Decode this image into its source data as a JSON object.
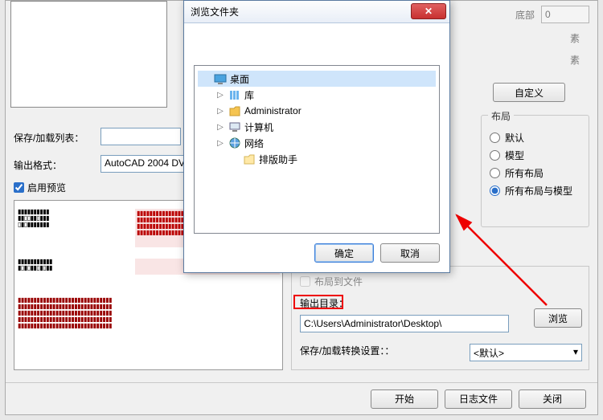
{
  "rightTop": {
    "bottomLabel": "底部",
    "bottomValue": "0",
    "unit1": "素",
    "unit2": "素"
  },
  "customBtn": "自定义",
  "layoutGroup": {
    "title": "布局",
    "options": [
      "默认",
      "模型",
      "所有布局",
      "所有布局与模型"
    ],
    "selected": 3
  },
  "saveLoadLabel": "保存/加载列表：",
  "outFmtLabel": "输出格式：",
  "outFmtValue": "AutoCAD 2004 DV",
  "enablePreview": "启用预览",
  "layoutToFile": "布局到文件",
  "outDirLabel": "输出目录：",
  "outDirValue": "C:\\Users\\Administrator\\Desktop\\",
  "browseBtn": "浏览",
  "saveCvtLabel": "保存/加载转换设置：：",
  "saveCvtValue": "<默认>",
  "bottom": {
    "start": "开始",
    "log": "日志文件",
    "close": "关闭"
  },
  "dialog": {
    "title": "浏览文件夹",
    "ok": "确定",
    "cancel": "取消",
    "tree": [
      {
        "icon": "desktop",
        "label": "桌面",
        "indent": 0,
        "exp": "",
        "sel": true
      },
      {
        "icon": "lib",
        "label": "库",
        "indent": 1,
        "exp": "▷"
      },
      {
        "icon": "user",
        "label": "Administrator",
        "indent": 1,
        "exp": "▷"
      },
      {
        "icon": "computer",
        "label": "计算机",
        "indent": 1,
        "exp": "▷"
      },
      {
        "icon": "net",
        "label": "网络",
        "indent": 1,
        "exp": "▷"
      },
      {
        "icon": "folder",
        "label": "排版助手",
        "indent": 2,
        "exp": ""
      }
    ]
  }
}
